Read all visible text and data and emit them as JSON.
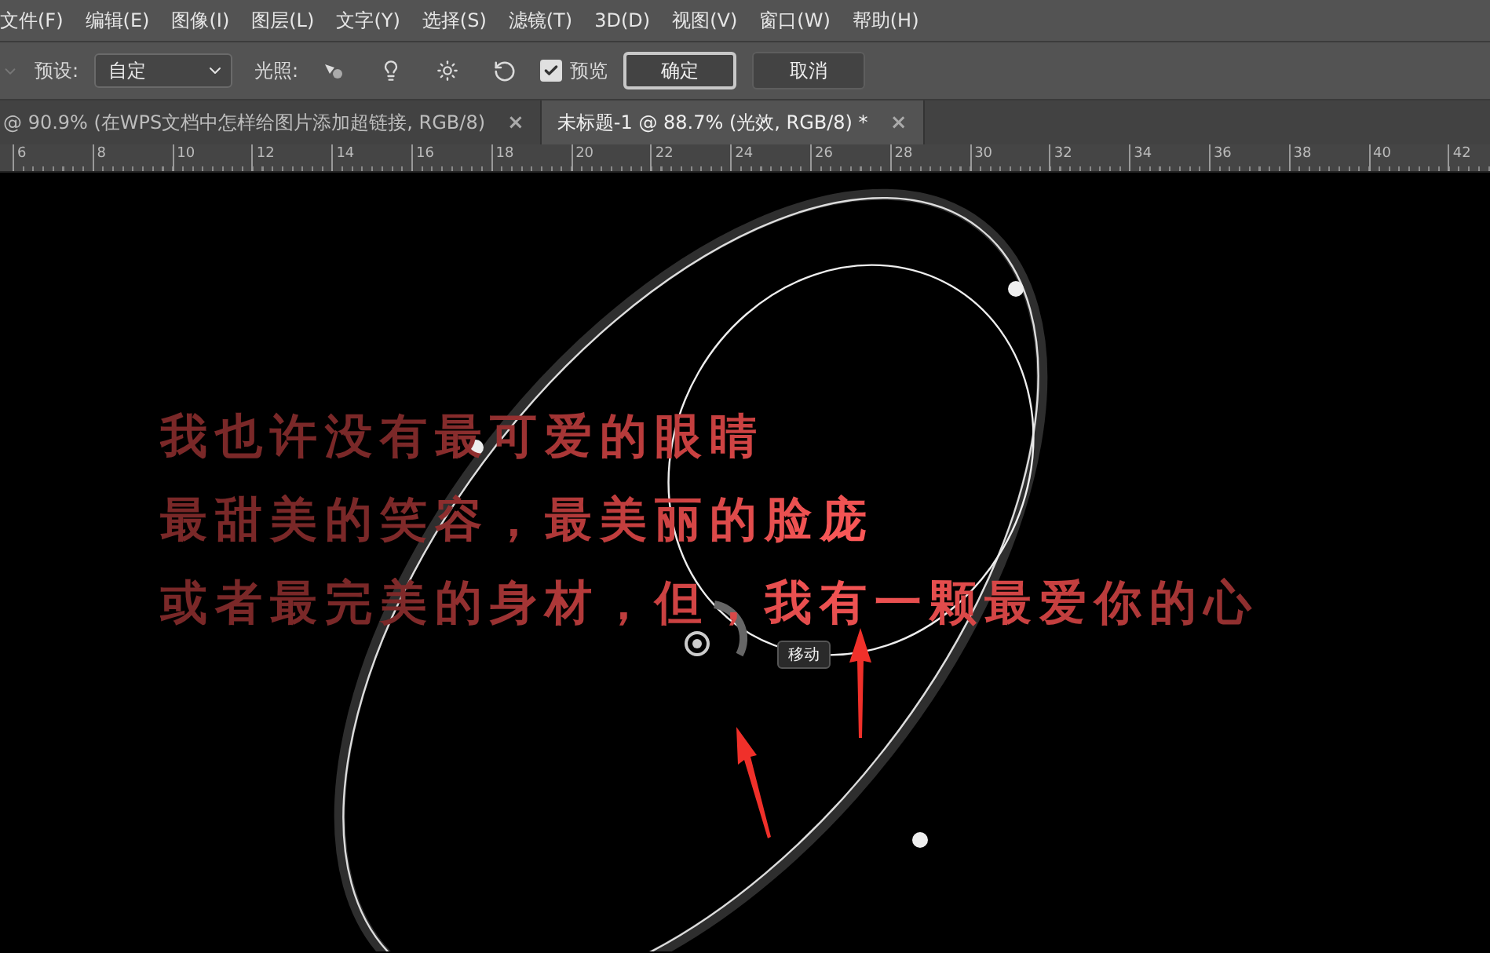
{
  "menu": [
    "文件(F)",
    "编辑(E)",
    "图像(I)",
    "图层(L)",
    "文字(Y)",
    "选择(S)",
    "滤镜(T)",
    "3D(D)",
    "视图(V)",
    "窗口(W)",
    "帮助(H)"
  ],
  "options": {
    "preset_label": "预设:",
    "preset_value": "自定",
    "lighting_label": "光照:",
    "preview": {
      "label": "预览",
      "checked": true
    },
    "buttons": [
      {
        "label": "确定",
        "selected": true
      },
      {
        "label": "取消",
        "selected": false
      }
    ]
  },
  "tabs": [
    {
      "label": "@ 90.9% (在WPS文档中怎样给图片添加超链接, RGB/8)",
      "close": "×",
      "selected": false
    },
    {
      "label": "未标题-1 @ 88.7% (光效, RGB/8) *",
      "close": "×",
      "selected": true
    }
  ],
  "ruler": [
    "6",
    "8",
    "10",
    "12",
    "14",
    "16",
    "18",
    "20",
    "22",
    "24",
    "26",
    "28",
    "30",
    "32",
    "34",
    "36",
    "38",
    "40",
    "42"
  ],
  "canvas": {
    "lines": [
      "我也许没有最可爱的眼睛",
      "最甜美的笑容，最美丽的脸庞",
      "或者最完美的身材，但，我有一颗最爱你的心"
    ],
    "tooltip": "移动"
  }
}
